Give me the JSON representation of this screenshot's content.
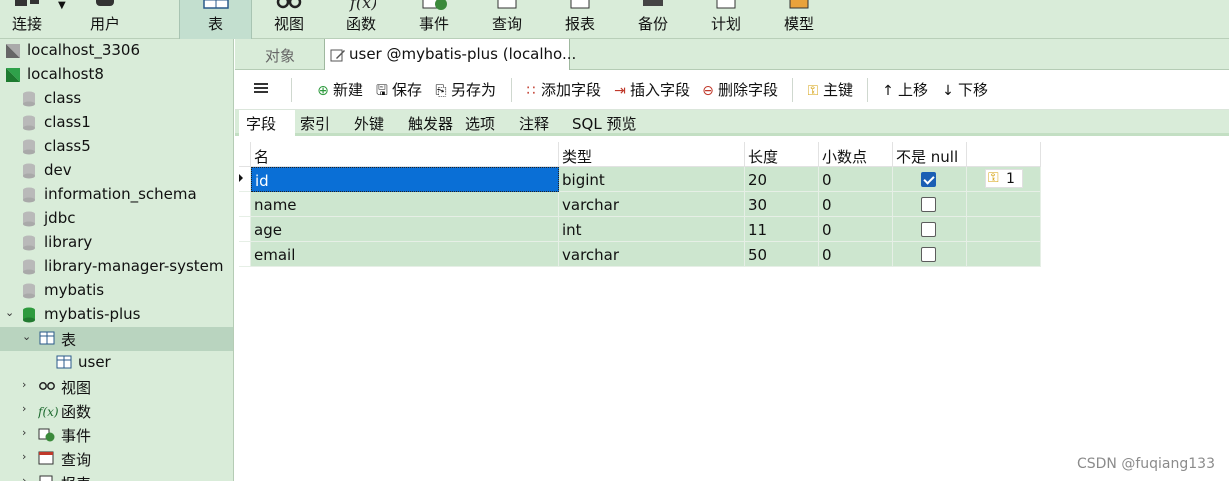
{
  "toolbar": {
    "buttons": [
      {
        "label": "连接",
        "icon": "plug-icon"
      },
      {
        "label": "用户",
        "icon": "user-icon"
      },
      {
        "label": "表",
        "icon": "table-icon",
        "active": true
      },
      {
        "label": "视图",
        "icon": "glasses-icon"
      },
      {
        "label": "函数",
        "icon": "function-icon"
      },
      {
        "label": "事件",
        "icon": "clock-icon"
      },
      {
        "label": "查询",
        "icon": "query-icon"
      },
      {
        "label": "报表",
        "icon": "report-icon"
      },
      {
        "label": "备份",
        "icon": "backup-icon"
      },
      {
        "label": "计划",
        "icon": "calendar-icon"
      },
      {
        "label": "模型",
        "icon": "model-icon"
      }
    ]
  },
  "sidebar": {
    "items": [
      {
        "label": "localhost_3306",
        "icon": "connection-icon"
      },
      {
        "label": "localhost8",
        "icon": "connection-icon"
      },
      {
        "label": "class",
        "icon": "database-icon"
      },
      {
        "label": "class1",
        "icon": "database-icon"
      },
      {
        "label": "class5",
        "icon": "database-icon"
      },
      {
        "label": "dev",
        "icon": "database-icon"
      },
      {
        "label": "information_schema",
        "icon": "database-icon"
      },
      {
        "label": "jdbc",
        "icon": "database-icon"
      },
      {
        "label": "library",
        "icon": "database-icon"
      },
      {
        "label": "library-manager-system",
        "icon": "database-icon"
      },
      {
        "label": "mybatis",
        "icon": "database-icon"
      },
      {
        "label": "mybatis-plus",
        "icon": "database-icon",
        "expanded": true
      },
      {
        "label": "表",
        "icon": "table-icon",
        "expanded": true,
        "selected": true
      },
      {
        "label": "user",
        "icon": "table-icon"
      },
      {
        "label": "视图",
        "icon": "glasses-icon"
      },
      {
        "label": "函数",
        "icon": "function-icon"
      },
      {
        "label": "事件",
        "icon": "clock-icon"
      },
      {
        "label": "查询",
        "icon": "query-icon"
      },
      {
        "label": "报表",
        "icon": "report-icon"
      }
    ]
  },
  "tabs": [
    {
      "label": "对象"
    },
    {
      "label": "user @mybatis-plus (localho..."
    }
  ],
  "actions": [
    {
      "label": "新建",
      "icon": "add-icon"
    },
    {
      "label": "保存",
      "icon": "save-icon"
    },
    {
      "label": "另存为",
      "icon": "save-as-icon"
    },
    {
      "label": "添加字段",
      "icon": "add-field-icon"
    },
    {
      "label": "插入字段",
      "icon": "insert-field-icon"
    },
    {
      "label": "删除字段",
      "icon": "delete-field-icon"
    },
    {
      "label": "主键",
      "icon": "key-icon"
    },
    {
      "label": "上移",
      "icon": "arrow-up-icon"
    },
    {
      "label": "下移",
      "icon": "arrow-down-icon"
    }
  ],
  "subtabs": [
    {
      "label": "字段"
    },
    {
      "label": "索引"
    },
    {
      "label": "外键"
    },
    {
      "label": "触发器"
    },
    {
      "label": "选项"
    },
    {
      "label": "注释"
    },
    {
      "label": "SQL 预览"
    }
  ],
  "grid": {
    "columns": [
      "名",
      "类型",
      "长度",
      "小数点",
      "不是 null",
      ""
    ],
    "rows": [
      {
        "name": "id",
        "type": "bigint",
        "length": "20",
        "decimals": "0",
        "not_null": true,
        "key": "1"
      },
      {
        "name": "name",
        "type": "varchar",
        "length": "30",
        "decimals": "0",
        "not_null": false,
        "key": ""
      },
      {
        "name": "age",
        "type": "int",
        "length": "11",
        "decimals": "0",
        "not_null": false,
        "key": ""
      },
      {
        "name": "email",
        "type": "varchar",
        "length": "50",
        "decimals": "0",
        "not_null": false,
        "key": ""
      }
    ]
  },
  "watermark": "CSDN @fuqiang133"
}
